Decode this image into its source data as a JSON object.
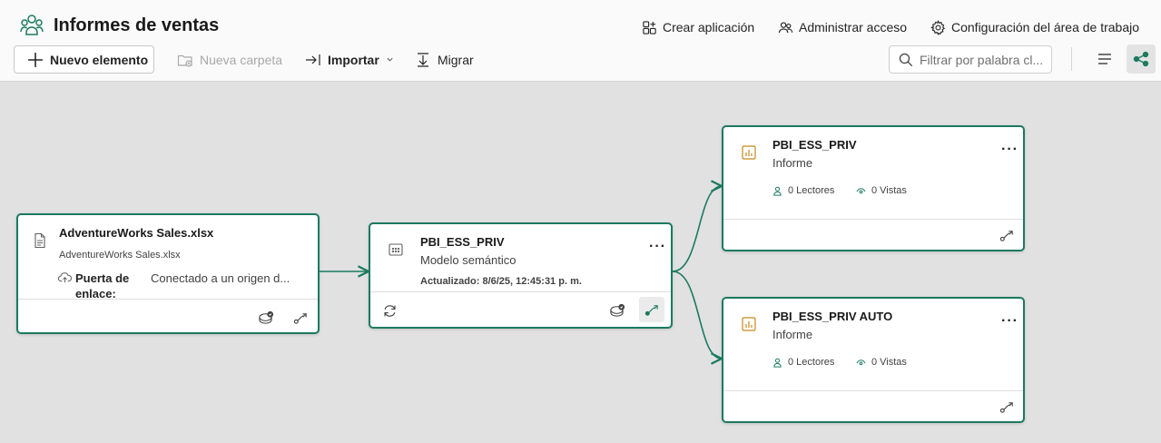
{
  "workspace": {
    "title": "Informes de ventas"
  },
  "header_actions": {
    "create_app": "Crear aplicación",
    "manage_access": "Administrar acceso",
    "workspace_settings": "Configuración del área de trabajo"
  },
  "toolbar": {
    "new_item": "Nuevo elemento",
    "new_folder": "Nueva carpeta",
    "import": "Importar",
    "migrate": "Migrar",
    "search_placeholder": "Filtrar por palabra cl..."
  },
  "cards": {
    "source": {
      "title": "AdventureWorks Sales.xlsx",
      "subtitle": "AdventureWorks Sales.xlsx",
      "gateway_label": "Puerta de enlace:",
      "gateway_value": "Conectado a un origen d..."
    },
    "model": {
      "title": "PBI_ESS_PRIV",
      "subtitle": "Modelo semántico",
      "updated": "Actualizado: 8/6/25, 12:45:31 p. m."
    },
    "report1": {
      "title": "PBI_ESS_PRIV",
      "subtitle": "Informe",
      "readers": "0 Lectores",
      "views": "0 Vistas"
    },
    "report2": {
      "title": "PBI_ESS_PRIV AUTO",
      "subtitle": "Informe",
      "readers": "0 Lectores",
      "views": "0 Vistas"
    }
  },
  "colors": {
    "accent": "#1b7a60",
    "report_icon": "#c8871a"
  }
}
